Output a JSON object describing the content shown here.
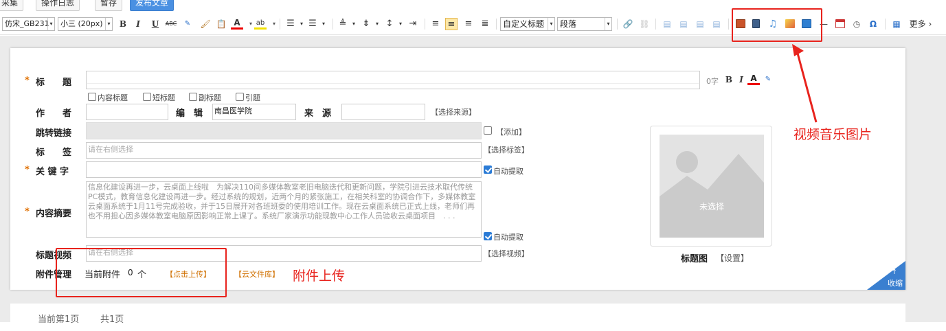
{
  "topbar": {
    "buttons": [
      "采集",
      "操作日志",
      "暂存",
      "发布文章"
    ]
  },
  "toolbar": {
    "font_family": "仿宋_GB231",
    "font_size": "小三 (20px)",
    "heading_select": "自定义标题",
    "paragraph_select": "段落",
    "more_label": "更多",
    "accent_color": "#4a90e2",
    "icons": [
      "bold-icon",
      "italic-icon",
      "underline-icon",
      "strikethrough-icon",
      "spellcheck-icon",
      "format-painter-icon",
      "paste-text-icon",
      "font-color-icon",
      "highlight-color-icon",
      "ordered-list-icon",
      "unordered-list-icon",
      "line-height-icon",
      "paragraph-spacing-icon",
      "indent-icon",
      "align-left-icon",
      "align-center-icon",
      "align-right-icon",
      "justify-icon",
      "link-icon",
      "unlink-icon",
      "image-left-icon",
      "image-none-icon",
      "image-right-icon",
      "image-center-icon",
      "image-insert-icon",
      "video-icon",
      "music-icon",
      "picture-icon",
      "gallery-icon",
      "horizontal-rule-icon",
      "date-icon",
      "time-icon",
      "special-char-icon",
      "table-icon"
    ]
  },
  "form": {
    "title_label": "标　　题",
    "title_count": "0字",
    "title_checkboxes": [
      "内容标题",
      "短标题",
      "副标题",
      "引题"
    ],
    "author_label": "作　　者",
    "editor_label": "编　辑",
    "editor_value": "南昌医学院",
    "source_label": "来　源",
    "select_source": "【选择来源】",
    "jump_link_label": "跳转链接",
    "add_link": "【添加】",
    "tags_label": "标　　签",
    "tags_placeholder": "请在右侧选择",
    "select_tags": "【选择标签】",
    "keywords_label": "关 键 字",
    "auto_extract_1": "自动提取",
    "summary_label": "内容摘要",
    "summary_text": "信息化建设再进一步，云桌面上线啦　为解决110间多媒体教室老旧电脑迭代和更新问题，学院引进云技术取代传统PC模式，教育信息化建设再进一步。经过系统的规划，近两个月的紧张施工，在相关科室的协调合作下，多媒体教室云桌面系统于1月11号完成验收，并于15日展开对各班班委的使用培训工作。现在云桌面系统已正式上线，老师们再也不用担心因多媒体教室电脑原因影响正常上课了。系统厂家演示功能现教中心工作人员验收云桌面项目　. . .",
    "auto_extract_2": "自动提取",
    "title_video_label": "标题视频",
    "video_placeholder": "请在右侧选择",
    "select_video": "【选择视频】",
    "attachment_label": "附件管理",
    "current_attachments_label": "当前附件",
    "attachment_count": "0",
    "attachment_unit": "个",
    "click_upload": "【点击上传】",
    "cloud_library": "【云文件库】",
    "thumb_unselected": "未选择",
    "thumb_label": "标题图",
    "thumb_setting": "【设置】",
    "collapse": "收缩"
  },
  "annotations": {
    "media_note": "视频音乐图片",
    "upload_note": "附件上传"
  },
  "pager": {
    "current": "当前第1页",
    "total": "共1页"
  }
}
